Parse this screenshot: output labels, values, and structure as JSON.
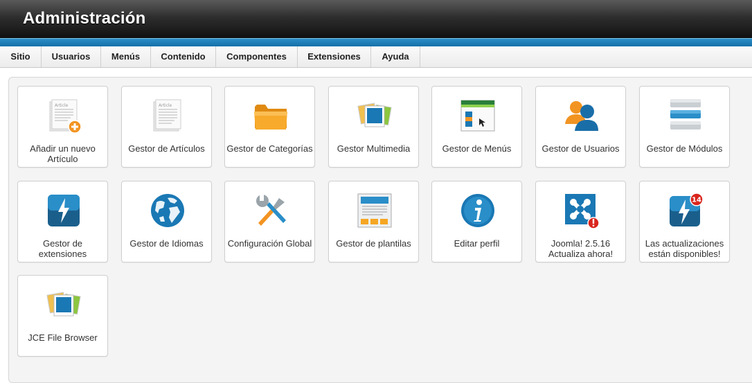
{
  "header": {
    "title": "Administración"
  },
  "menu": {
    "items": [
      "Sitio",
      "Usuarios",
      "Menús",
      "Contenido",
      "Componentes",
      "Extensiones",
      "Ayuda"
    ]
  },
  "tiles": [
    {
      "label": "Añadir un nuevo Artículo",
      "icon": "add-article-icon"
    },
    {
      "label": "Gestor de Artículos",
      "icon": "article-manager-icon"
    },
    {
      "label": "Gestor de Categorías",
      "icon": "folder-icon"
    },
    {
      "label": "Gestor Multimedia",
      "icon": "media-icon"
    },
    {
      "label": "Gestor de Menús",
      "icon": "menu-manager-icon"
    },
    {
      "label": "Gestor de Usuarios",
      "icon": "users-icon"
    },
    {
      "label": "Gestor de Módulos",
      "icon": "modules-icon"
    },
    {
      "label": "Gestor de extensiones",
      "icon": "extensions-icon"
    },
    {
      "label": "Gestor de Idiomas",
      "icon": "globe-icon"
    },
    {
      "label": "Configuración Global",
      "icon": "tools-icon"
    },
    {
      "label": "Gestor de plantilas",
      "icon": "templates-icon"
    },
    {
      "label": "Editar perfil",
      "icon": "info-icon"
    },
    {
      "label": "Joomla! 2.5.16 Actualiza ahora!",
      "icon": "joomla-update-icon"
    },
    {
      "label": "Las actualizaciones están disponibles!",
      "icon": "updates-available-icon",
      "badge": "14"
    },
    {
      "label": "JCE File Browser",
      "icon": "jce-file-browser-icon"
    }
  ],
  "icon_text": {
    "article_doc": "Article"
  },
  "colors": {
    "accent_blue": "#1a78b4",
    "header_dark": "#1c1c1c",
    "folder_orange": "#f5a623",
    "alert_red": "#d9251c"
  }
}
